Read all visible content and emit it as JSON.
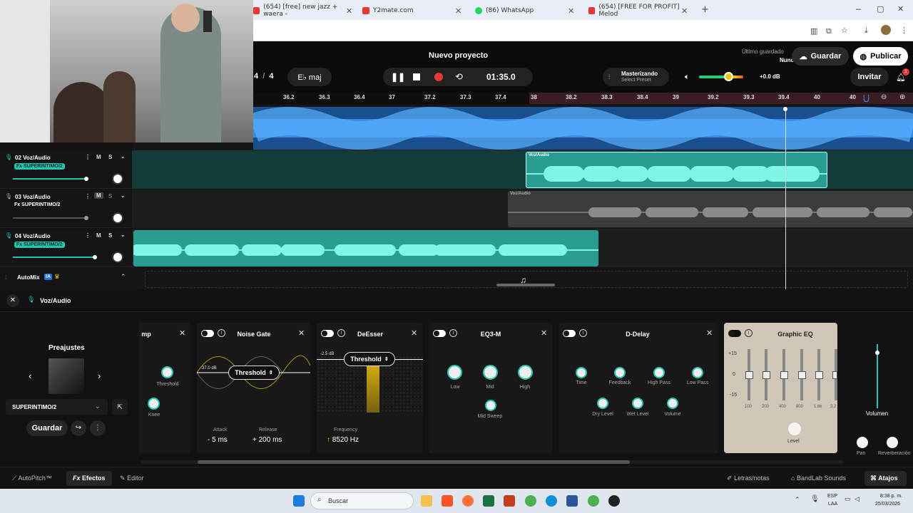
{
  "browser": {
    "tabs": [
      {
        "label": "(654) [free] new jazz + waera -",
        "color": "#e53935"
      },
      {
        "label": "Y2mate.com",
        "color": "#e53935"
      },
      {
        "label": "(86) WhatsApp",
        "color": "#25d366"
      },
      {
        "label": "(654) [FREE FOR PROFIT] Melod",
        "color": "#e53935"
      }
    ],
    "new_tab": "+",
    "win_min": "─",
    "win_max": "▢",
    "win_close": "✕"
  },
  "header": {
    "project_title": "Nuevo proyecto",
    "last_saved_label": "Último guardado",
    "last_saved_value": "Nunca",
    "save_button": "Guardar",
    "publish_button": "Publicar",
    "time_sig_top": "4",
    "time_sig_sep": "/",
    "time_sig_bottom": "4",
    "key": "E♭ maj",
    "time_display": "01:35.0",
    "mastering_label": "Masterizando",
    "mastering_preset": "Select Preset",
    "volume_db": "+0.0 dB",
    "invite_button": "Invitar",
    "notif_count": "1"
  },
  "ruler": {
    "ticks": [
      "36.2",
      "36.3",
      "36.4",
      "37",
      "37.2",
      "37.3",
      "37.4",
      "38",
      "38.2",
      "38.3",
      "38.4",
      "39",
      "39.2",
      "39.3",
      "39.4",
      "40",
      "40"
    ]
  },
  "tracks": [
    {
      "name": "02 Voz/Audio",
      "fx": "SUPERINTIMO/2",
      "fx_active": true,
      "m": "M",
      "s": "S",
      "clip_label": "Voz/Audio"
    },
    {
      "name": "03 Voz/Audio",
      "fx": "SUPERINTIMO/2",
      "fx_active": false,
      "m": "M",
      "s": "S",
      "clip_label": "Voz/Audio"
    },
    {
      "name": "04 Voz/Audio",
      "fx": "SUPERINTIMO/2",
      "fx_active": true,
      "m": "M",
      "s": "S"
    }
  ],
  "fx_prefix": "Fx",
  "automix": {
    "label": "AutoMix",
    "badge": "IA"
  },
  "panel": {
    "title": "Voz/Audio",
    "presets_label": "Preajustes",
    "preset_name": "SUPERINTIMO/2",
    "save_button": "Guardar"
  },
  "plugins": {
    "comp": {
      "title": "mp",
      "threshold": "Threshold",
      "knee": "Knee"
    },
    "gate": {
      "title": "Noise Gate",
      "db": "-37.0 dB",
      "threshold": "Threshold",
      "attack_label": "Attack",
      "attack_value": "5 ms",
      "release_label": "Release",
      "release_value": "200 ms"
    },
    "deesser": {
      "title": "DeEsser",
      "db": "-2.5 dB",
      "threshold": "Threshold",
      "freq_label": "Frequency",
      "freq_value": "8520 Hz"
    },
    "eq3": {
      "title": "EQ3-M",
      "low": "Low",
      "mid": "Mid",
      "high": "High",
      "sweep": "Mid Sweep"
    },
    "delay": {
      "title": "D-Delay",
      "time": "Time",
      "feedback": "Feedback",
      "highpass": "High Pass",
      "lowpass": "Low Pass",
      "dry": "Dry Level",
      "wet": "Wet Level",
      "volume": "Volume"
    },
    "geq": {
      "title": "Graphic EQ",
      "p15": "+15",
      "zero": "0",
      "m15": "-15",
      "bands": [
        "100",
        "200",
        "400",
        "800",
        "1.6k",
        "3.2"
      ],
      "level": "Level"
    }
  },
  "right_panel": {
    "volume": "Volumen",
    "pan": "Pan",
    "reverb": "Reverberación"
  },
  "footer": {
    "autopitch": "AutoPitch™",
    "effects": "Efectos",
    "editor": "Editor",
    "lyrics": "Letras/notas",
    "sounds": "BandLab Sounds",
    "shortcuts": "Atajos"
  },
  "taskbar": {
    "search": "Buscar",
    "lang_top": "ESP",
    "lang_bottom": "LAA",
    "time": "8:38 p. m.",
    "date": "25/03/2026"
  }
}
